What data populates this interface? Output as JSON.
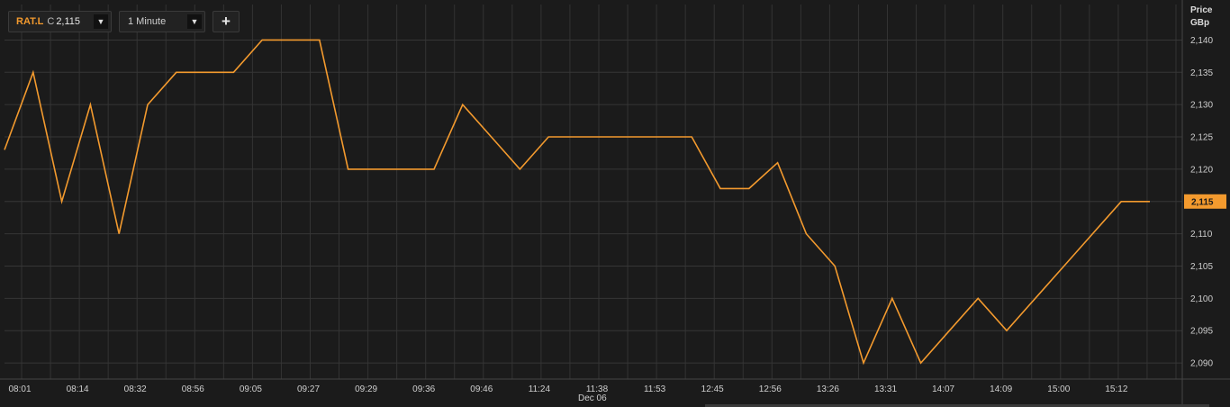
{
  "toolbar": {
    "ric": "RAT.L",
    "close_prefix": "C",
    "close_value": "2,115",
    "interval": "1 Minute",
    "add_label": "+"
  },
  "axis": {
    "unit_line1": "Price",
    "unit_line2": "GBp"
  },
  "date_label": "Dec 06",
  "colors": {
    "background": "#1b1b1b",
    "grid": "#3a3a3a",
    "line": "#f39a2e",
    "last_price_badge": "#f39a2e"
  },
  "chart_data": {
    "type": "line",
    "series": [
      {
        "values": [
          2123,
          2135,
          2115,
          2130,
          2110,
          2130,
          2135,
          2135,
          2135,
          2140,
          2140,
          2140,
          2120,
          2120,
          2120,
          2120,
          2130,
          2125,
          2120,
          2125,
          2125,
          2125,
          2125,
          2125,
          2125,
          2117,
          2117,
          2121,
          2110,
          2105,
          2090,
          2100,
          2090,
          2095,
          2100,
          2095,
          2100,
          2105,
          2110,
          2115,
          2115
        ]
      }
    ],
    "x_tick_labels": [
      "08:01",
      "08:14",
      "08:32",
      "08:56",
      "09:05",
      "09:27",
      "09:29",
      "09:36",
      "09:46",
      "11:24",
      "11:38",
      "11:53",
      "12:45",
      "12:56",
      "13:26",
      "13:31",
      "14:07",
      "14:09",
      "15:00",
      "15:12"
    ],
    "y_ticks": [
      2090,
      2095,
      2100,
      2105,
      2110,
      2115,
      2120,
      2125,
      2130,
      2135,
      2140
    ],
    "y_tick_labels": [
      "2,090",
      "2,095",
      "2,100",
      "2,105",
      "2,110",
      "2,115",
      "2,120",
      "2,125",
      "2,130",
      "2,135",
      "2,140"
    ],
    "ylim": [
      2087.5,
      2145.5
    ],
    "last_value": 2115,
    "last_value_label": "2,115",
    "grid": true
  }
}
